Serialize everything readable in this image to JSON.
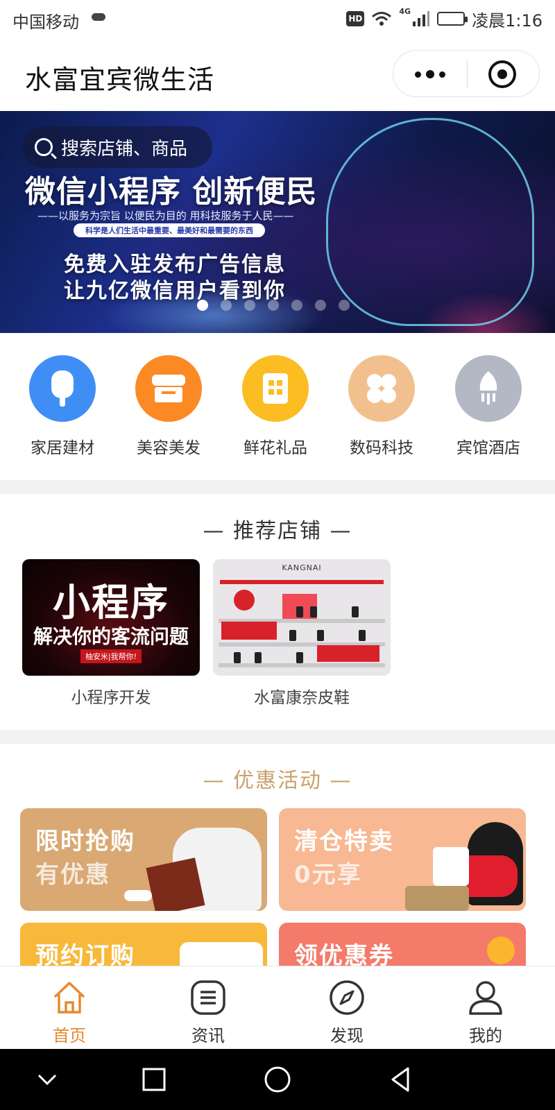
{
  "status_bar": {
    "carrier": "中国移动",
    "network": "4G",
    "hd": "HD",
    "time": "凌晨1:16"
  },
  "app": {
    "title": "水富宜宾微生活"
  },
  "banner": {
    "search_placeholder": "搜索店铺、商品",
    "headline": "微信小程序 创新便民",
    "subline": "——以服务为宗旨 以便民为目的 用科技服务于人民——",
    "pill_text": "科学是人们生活中最重要、最美好和最需要的东西",
    "line1": "免费入驻发布广告信息",
    "line2": "让九亿微信用户看到你",
    "slide_count": 7,
    "active_slide": 1
  },
  "categories": [
    {
      "label": "家居建材",
      "icon": "popsicle-icon",
      "color": "#3f8ef5"
    },
    {
      "label": "美容美发",
      "icon": "shop-awning-icon",
      "color": "#fb8a25"
    },
    {
      "label": "鲜花礼品",
      "icon": "building-icon",
      "color": "#fbbd22"
    },
    {
      "label": "数码科技",
      "icon": "clover-icon",
      "color": "#f2c08e"
    },
    {
      "label": "宾馆酒店",
      "icon": "rocket-icon",
      "color": "#b4b8c4"
    }
  ],
  "recommend": {
    "title": "推荐店铺",
    "stores": [
      {
        "name": "小程序开发",
        "img_big": "小程序",
        "img_mid": "解决你的客流问题",
        "img_tag": "柚安米|我帮你!"
      },
      {
        "name": "水富康奈皮鞋",
        "img_brand": "KANGNAI"
      }
    ]
  },
  "promotions": {
    "title": "优惠活动",
    "items": [
      {
        "line1": "限时抢购",
        "line2": "有优惠"
      },
      {
        "line1": "清仓特卖",
        "line2": "0元享"
      },
      {
        "line1": "预约订购",
        "line2": ""
      },
      {
        "line1": "领优惠券",
        "line2": ""
      }
    ]
  },
  "tabs": [
    {
      "label": "首页",
      "icon": "home-icon",
      "active": true
    },
    {
      "label": "资讯",
      "icon": "news-icon",
      "active": false
    },
    {
      "label": "发现",
      "icon": "compass-icon",
      "active": false
    },
    {
      "label": "我的",
      "icon": "user-icon",
      "active": false
    }
  ],
  "colors": {
    "accent": "#e48a2e",
    "section_gold": "#c8a06a",
    "separator": "#f2f2f2"
  }
}
